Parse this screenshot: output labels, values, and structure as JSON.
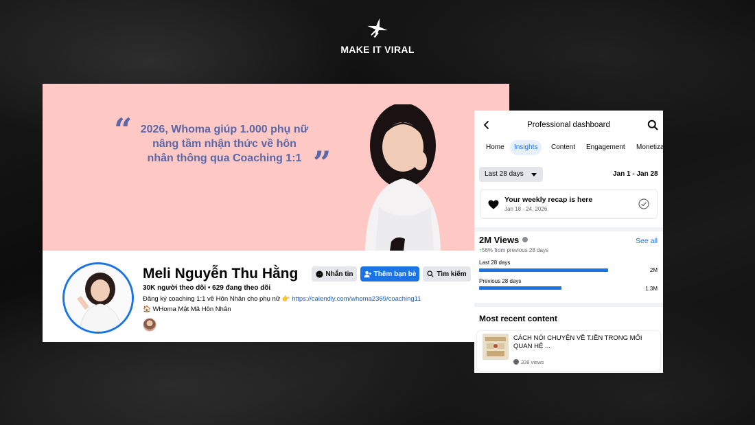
{
  "brand": {
    "name": "MAKE IT VIRAL",
    "logo_icon": "sparkle-logo-icon"
  },
  "profile": {
    "cover_quote": "2026, Whoma giúp 1.000 phụ nữ nâng tầm nhận thức về hôn nhân thông qua Coaching 1:1",
    "name": "Meli Nguyễn Thu Hằng",
    "stats": "30K người theo dõi • 629 đang theo dõi",
    "bio_text": "Đăng ký coaching 1:1 về Hôn Nhân cho phụ nữ 👉 ",
    "bio_link": "https://calendly.com/whoma2369/coaching11",
    "workplace": "WHoma Mật Mã Hôn Nhân",
    "buttons": {
      "message": "Nhắn tin",
      "add_friend": "Thêm bạn bè",
      "search": "Tìm kiếm"
    },
    "colors": {
      "cover": "#fec9c5",
      "quote": "#5a67a8",
      "primary": "#1b74e4"
    }
  },
  "dashboard": {
    "title": "Professional dashboard",
    "tabs": [
      {
        "label": "Home",
        "active": false
      },
      {
        "label": "Insights",
        "active": true
      },
      {
        "label": "Content",
        "active": false
      },
      {
        "label": "Engagement",
        "active": false
      },
      {
        "label": "Monetiza",
        "active": false
      }
    ],
    "date_filter": "Last 28 days",
    "date_range": "Jan 1 - Jan 28",
    "recap": {
      "title": "Your weekly recap is here",
      "dates": "Jan 18 - 24, 2026"
    },
    "views": {
      "title": "2M Views",
      "see_all": "See all",
      "growth_arrow": "↑",
      "growth_text": "56% from previous 28 days",
      "bars": [
        {
          "label": "Last 28 days",
          "value": "2M",
          "fraction": 1.0
        },
        {
          "label": "Previous 28 days",
          "value": "1.3M",
          "fraction": 0.64
        }
      ]
    },
    "recent": {
      "title": "Most recent content",
      "post_title": "CÁCH NÓI CHUYỆN VỀ T.IỀN TRONG MỐI QUAN HỆ ...",
      "post_views": "338 views"
    }
  }
}
